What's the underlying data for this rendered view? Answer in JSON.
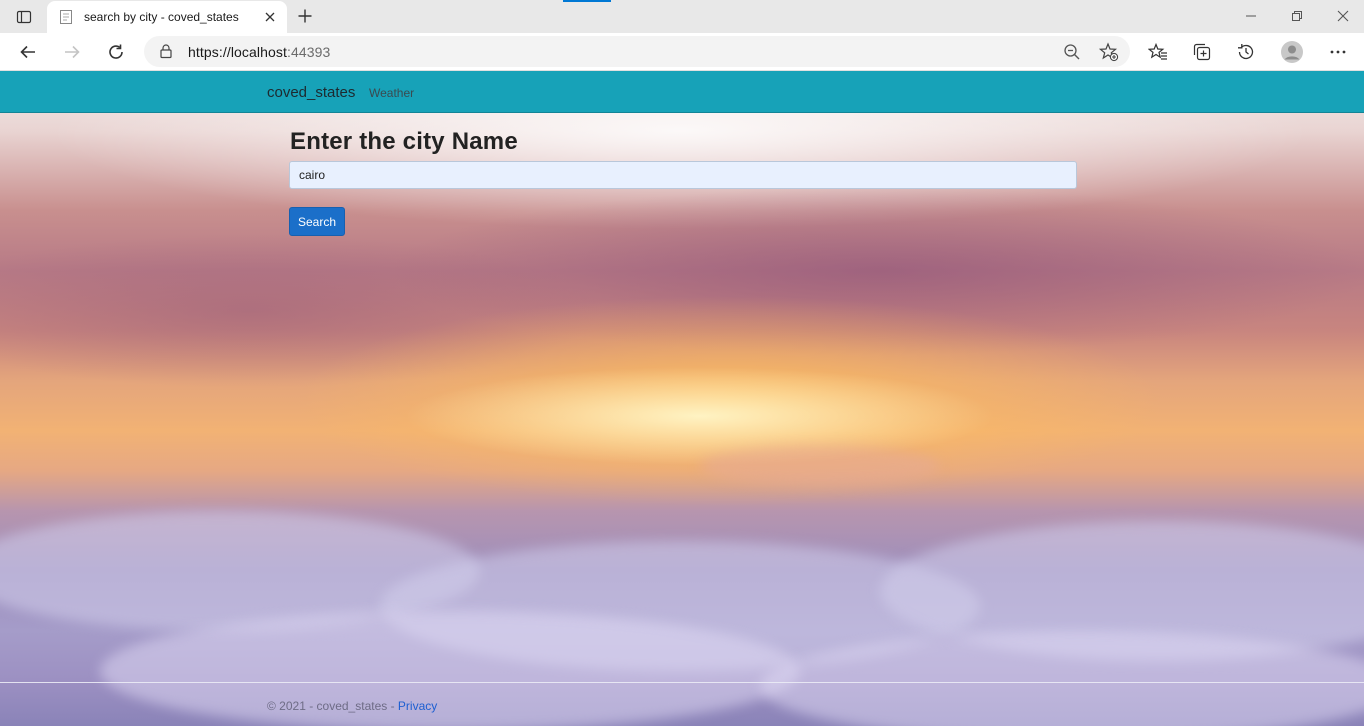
{
  "browser": {
    "tab_title": "search by city - coved_states",
    "url_host": "https://localhost",
    "url_port": ":44393"
  },
  "navbar": {
    "brand": "coved_states",
    "links": [
      "Weather"
    ],
    "color": "#17a2b8"
  },
  "main": {
    "heading": "Enter the city Name",
    "city_input_value": "cairo",
    "search_button_label": "Search",
    "button_color": "#1b6fc9"
  },
  "footer": {
    "copyright": "© 2021 - coved_states - ",
    "privacy_link": "Privacy"
  },
  "icons": [
    "tab-actions-icon",
    "page-favicon-icon",
    "close-tab-icon",
    "new-tab-icon",
    "minimize-icon",
    "restore-icon",
    "close-window-icon",
    "back-icon",
    "forward-icon",
    "refresh-icon",
    "lock-icon",
    "zoom-icon",
    "add-favorite-icon",
    "favorites-icon",
    "collections-icon",
    "history-icon",
    "profile-avatar-icon",
    "more-icon"
  ]
}
